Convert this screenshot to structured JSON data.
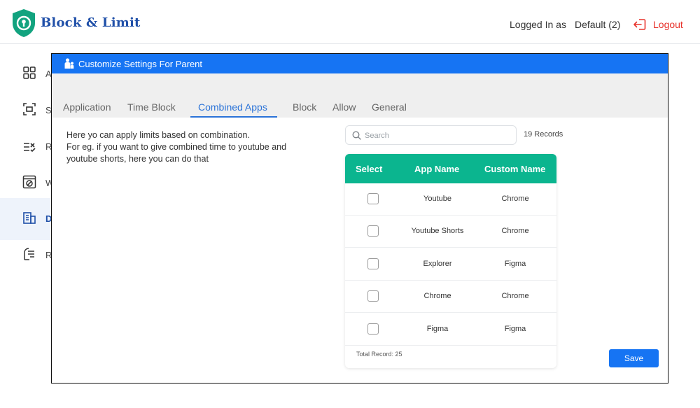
{
  "header": {
    "brand": "Block & Limit",
    "logged_in_label": "Logged In as",
    "account": "Default (2)",
    "logout_label": "Logout"
  },
  "sidebar": {
    "items": [
      {
        "label": "A",
        "icon": "apps-grid-icon"
      },
      {
        "label": "S",
        "icon": "screen-capture-icon"
      },
      {
        "label": "R",
        "icon": "rules-icon"
      },
      {
        "label": "W",
        "icon": "website-block-icon"
      },
      {
        "label": "D",
        "icon": "building-icon",
        "active": true
      },
      {
        "label": "R",
        "icon": "report-icon"
      }
    ]
  },
  "modal": {
    "title": "Customize Settings For Parent",
    "tabs": [
      {
        "label": "Application"
      },
      {
        "label": "Time Block"
      },
      {
        "label": "Combined Apps",
        "active": true
      },
      {
        "label": "Block"
      },
      {
        "label": "Allow"
      },
      {
        "label": "General"
      }
    ],
    "description": "Here yo can apply limits based on combination.\nFor eg. if you want to give combined time to youtube and youtube shorts, here you can do that",
    "search": {
      "placeholder": "Search",
      "value": ""
    },
    "records": "19 Records",
    "table": {
      "headers": {
        "select": "Select",
        "app": "App Name",
        "custom": "Custom Name"
      },
      "rows": [
        {
          "app": "Youtube",
          "custom": "Chrome",
          "checked": false
        },
        {
          "app": "Youtube Shorts",
          "custom": "Chrome",
          "checked": false
        },
        {
          "app": "Explorer",
          "custom": "Figma",
          "checked": false
        },
        {
          "app": "Chrome",
          "custom": "Chrome",
          "checked": false
        },
        {
          "app": "Figma",
          "custom": "Figma",
          "checked": false
        }
      ],
      "total": "Total Record: 25"
    },
    "save_label": "Save"
  },
  "colors": {
    "brand": "#1f4fa8",
    "logo_green": "#12a37f",
    "titlebar": "#1674f3",
    "table_header": "#0bb58f",
    "logout": "#e8332c",
    "active_tab": "#2b73d8"
  }
}
